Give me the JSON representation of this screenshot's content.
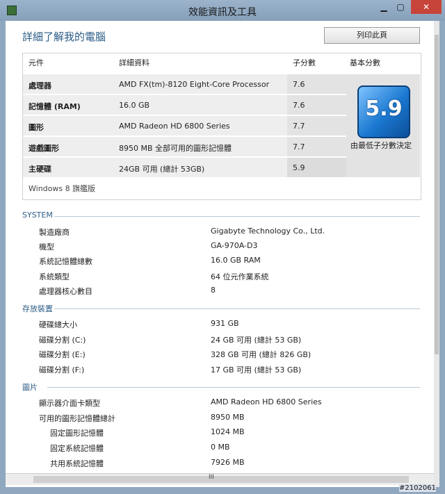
{
  "window": {
    "title": "效能資訊及工具"
  },
  "page": {
    "heading": "詳細了解我的電腦",
    "print_label": "列印此頁"
  },
  "score_table": {
    "headers": [
      "元件",
      "詳細資料",
      "子分數",
      "基本分數"
    ],
    "rows": [
      {
        "component": "處理器",
        "details": "AMD FX(tm)-8120 Eight-Core Processor",
        "subscore": "7.6"
      },
      {
        "component": "記憶體 (RAM)",
        "details": "16.0 GB",
        "subscore": "7.6"
      },
      {
        "component": "圖形",
        "details": "AMD Radeon HD 6800 Series",
        "subscore": "7.7"
      },
      {
        "component": "遊戲圖形",
        "details": "8950 MB 全部可用的圖形記憶體",
        "subscore": "7.7"
      },
      {
        "component": "主硬碟",
        "details": "24GB 可用 (總計 53GB)",
        "subscore": "5.9"
      }
    ],
    "base_score": "5.9",
    "base_note": "由最低子分數決定",
    "edition": "Windows 8 旗艦版"
  },
  "system": {
    "title": "SYSTEM",
    "items": [
      {
        "label": "製造廠商",
        "value": "Gigabyte Technology Co., Ltd."
      },
      {
        "label": "機型",
        "value": "GA-970A-D3"
      },
      {
        "label": "系統記憶體總數",
        "value": "16.0 GB RAM"
      },
      {
        "label": "系統類型",
        "value": "64 位元作業系統"
      },
      {
        "label": "處理器核心數目",
        "value": "8"
      }
    ]
  },
  "storage": {
    "title": "存放裝置",
    "items": [
      {
        "label": "硬碟總大小",
        "value": "931 GB"
      },
      {
        "label": "磁碟分割 (C:)",
        "value": "24 GB 可用 (總計 53 GB)"
      },
      {
        "label": "磁碟分割 (E:)",
        "value": "328 GB 可用 (總計 826 GB)"
      },
      {
        "label": "磁碟分割 (F:)",
        "value": "17 GB 可用 (總計 53 GB)"
      }
    ]
  },
  "graphics": {
    "title": "圖片",
    "items": [
      {
        "label": "顯示器介面卡類型",
        "value": "AMD Radeon HD 6800 Series"
      },
      {
        "label": "可用的圖形記憶體總計",
        "value": "8950 MB"
      },
      {
        "label": "固定圖形記憶體",
        "value": "1024 MB"
      },
      {
        "label": "固定系統記憶體",
        "value": "0 MB"
      },
      {
        "label": "共用系統記憶體",
        "value": "7926 MB"
      }
    ]
  },
  "scrollbar": {
    "grip": "III"
  },
  "watermark": "#2102061"
}
